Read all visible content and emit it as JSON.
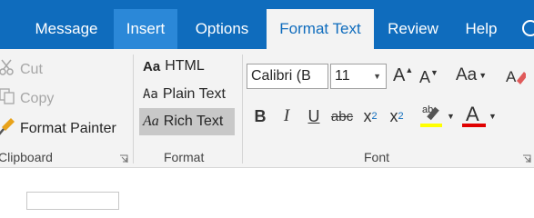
{
  "tabs": [
    "Message",
    "Insert",
    "Options",
    "Format Text",
    "Review",
    "Help"
  ],
  "clipboard": {
    "cut": "Cut",
    "copy": "Copy",
    "format_painter": "Format Painter",
    "group_label": "Clipboard"
  },
  "format": {
    "html": "HTML",
    "plain_text": "Plain Text",
    "rich_text": "Rich Text",
    "aa": "Aa",
    "group_label": "Format"
  },
  "font": {
    "font_name": "Calibri (B",
    "font_size": "11",
    "bold": "B",
    "italic": "I",
    "underline": "U",
    "strikethrough": "abc",
    "subscript": "x",
    "subscript_mark": "2",
    "superscript": "x",
    "superscript_mark": "2",
    "highlight": "ab",
    "font_color": "A",
    "grow": "A",
    "shrink": "A",
    "change_case": "Aa",
    "group_label": "Font"
  },
  "colors": {
    "tab_bar": "#0f6cbd",
    "tab_hover": "#2b88d8",
    "ribbon": "#f3f3f3",
    "highlight_yellow": "#ffff00",
    "font_color_red": "#e00000",
    "format_painter_gold": "#e8a21a"
  },
  "icons": [
    "scissors-icon",
    "copy-icon",
    "format-painter-icon",
    "dialog-launcher-icon",
    "eraser-icon",
    "search-icon"
  ]
}
